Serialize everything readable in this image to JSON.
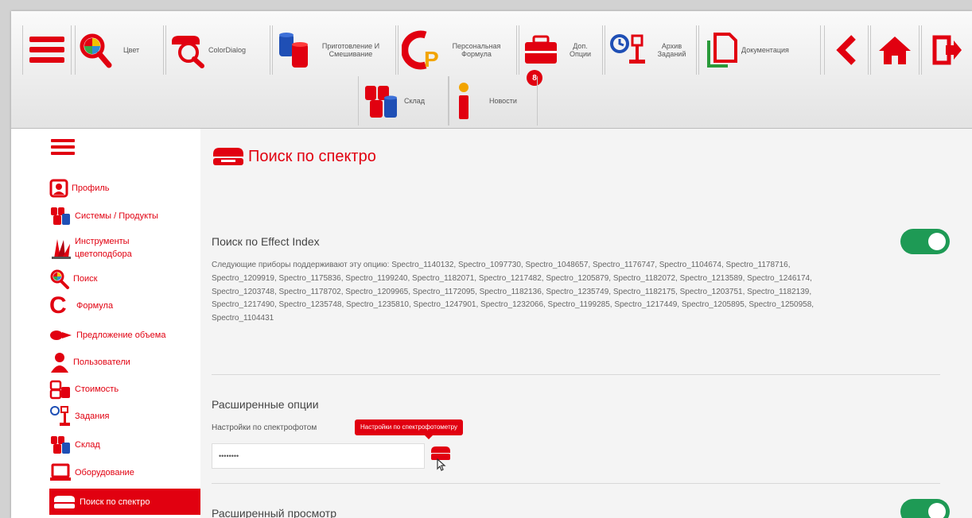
{
  "colors": {
    "accent": "#e10010",
    "toggle_on": "#1e9a55",
    "tooltip": "#e10010"
  },
  "topbar": {
    "menu_icon": "hamburger-icon",
    "items": [
      {
        "label": "Цвет",
        "icon": "color-search-icon"
      },
      {
        "label": "ColorDialog",
        "icon": "spectro-search-icon"
      },
      {
        "label": "Приготовление И Смешивание",
        "icon": "mixing-cans-icon"
      },
      {
        "label": "Персональная Формула",
        "icon": "cp-formula-icon"
      },
      {
        "label": "Доп. Опции",
        "icon": "briefcase-icon",
        "badge": "8"
      },
      {
        "label": "Архив Заданий",
        "icon": "archive-scale-icon"
      },
      {
        "label": "Документация",
        "icon": "documents-icon"
      },
      {
        "label": "Склад",
        "icon": "warehouse-icon"
      },
      {
        "label": "Новости",
        "icon": "info-icon"
      }
    ]
  },
  "sidebar": {
    "items": [
      {
        "label": "Профиль",
        "icon": "profile-icon"
      },
      {
        "label": "Системы / Продукты",
        "icon": "products-icon"
      },
      {
        "label": "Инструменты цветоподбора",
        "icon": "fan-deck-icon"
      },
      {
        "label": "Поиск",
        "icon": "search-icon"
      },
      {
        "label": "Формула",
        "icon": "formula-icon"
      },
      {
        "label": "Предложение объема",
        "icon": "volume-icon"
      },
      {
        "label": "Пользователи",
        "icon": "users-icon"
      },
      {
        "label": "Стоимость",
        "icon": "cost-icon"
      },
      {
        "label": "Задания",
        "icon": "jobs-icon"
      },
      {
        "label": "Склад",
        "icon": "warehouse-icon"
      },
      {
        "label": "Оборудование",
        "icon": "laptop-icon"
      },
      {
        "label": "Поиск по спектро",
        "icon": "spectro-icon",
        "active": true
      }
    ]
  },
  "main": {
    "page_title": "Поиск по спектро",
    "effect_index": {
      "title": "Поиск по Effect Index",
      "description": "Следующие приборы поддерживают эту опцию: Spectro_1140132, Spectro_1097730, Spectro_1048657, Spectro_1176747, Spectro_1104674, Spectro_1178716, Spectro_1209919, Spectro_1175836, Spectro_1199240, Spectro_1182071, Spectro_1217482, Spectro_1205879, Spectro_1182072, Spectro_1213589, Spectro_1246174, Spectro_1203748, Spectro_1178702, Spectro_1209965, Spectro_1172095, Spectro_1182136, Spectro_1235749, Spectro_1182175, Spectro_1203751, Spectro_1182139, Spectro_1217490, Spectro_1235748, Spectro_1235810, Spectro_1247901, Spectro_1232066, Spectro_1199285, Spectro_1217449, Spectro_1205895, Spectro_1250958, Spectro_1104431",
      "toggle": "on"
    },
    "advanced": {
      "title": "Расширенные опции",
      "setting_label": "Настройки по спектрофотом",
      "tooltip": "Настройки по спектрофотометру",
      "password_value": "••••••••"
    },
    "advanced_view": {
      "title": "Расширенный просмотр",
      "toggle": "on"
    }
  }
}
